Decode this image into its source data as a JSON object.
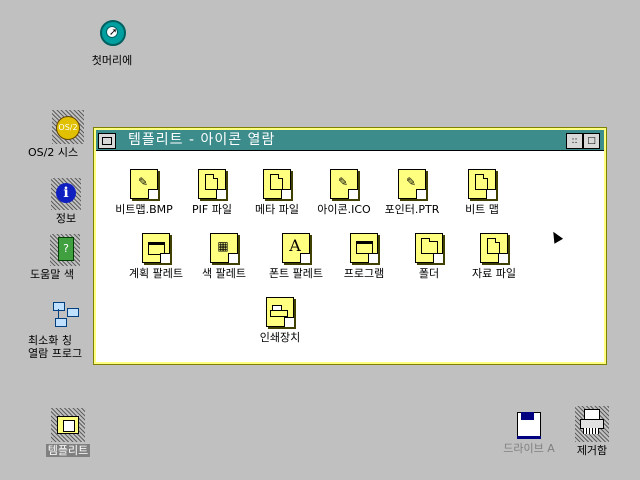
{
  "desktop": {
    "icons": [
      {
        "label": "첫머리에",
        "icon": "start-here-icon"
      },
      {
        "label": "OS/2 시스",
        "icon": "os2-system-icon"
      },
      {
        "label": "정보",
        "icon": "information-icon"
      },
      {
        "label": "도움말 색",
        "icon": "help-index-icon"
      },
      {
        "label1": "최소화 칭",
        "label2": "열람 프로그",
        "icon": "minimized-viewer-icon"
      },
      {
        "label": "템플리트",
        "icon": "templates-folder-icon"
      },
      {
        "label": "드라이브 A",
        "icon": "floppy-drive-icon"
      },
      {
        "label": "제거함",
        "icon": "shredder-icon"
      }
    ]
  },
  "window": {
    "title": "템플리트 - 아이콘 열람",
    "buttons": {
      "minimize": "::",
      "maximize": "□"
    },
    "items": [
      {
        "label": "비트맵.BMP",
        "glyph": "✎"
      },
      {
        "label": "PIF 파일",
        "glyph": "doc"
      },
      {
        "label": "메타 파일",
        "glyph": "doc"
      },
      {
        "label": "아이콘.ICO",
        "glyph": "✎"
      },
      {
        "label": "포인터.PTR",
        "glyph": "✎"
      },
      {
        "label": "비트 맵",
        "glyph": "doc"
      },
      {
        "label": "계획 팔레트",
        "glyph": "plan"
      },
      {
        "label": "색 팔레트",
        "glyph": "▦"
      },
      {
        "label": "폰트 팔레트",
        "glyph": "A"
      },
      {
        "label": "프로그램",
        "glyph": "frame"
      },
      {
        "label": "폴더",
        "glyph": "folder"
      },
      {
        "label": "자료 파일",
        "glyph": "doc"
      },
      {
        "label": "인쇄장치",
        "glyph": "printer"
      }
    ]
  }
}
